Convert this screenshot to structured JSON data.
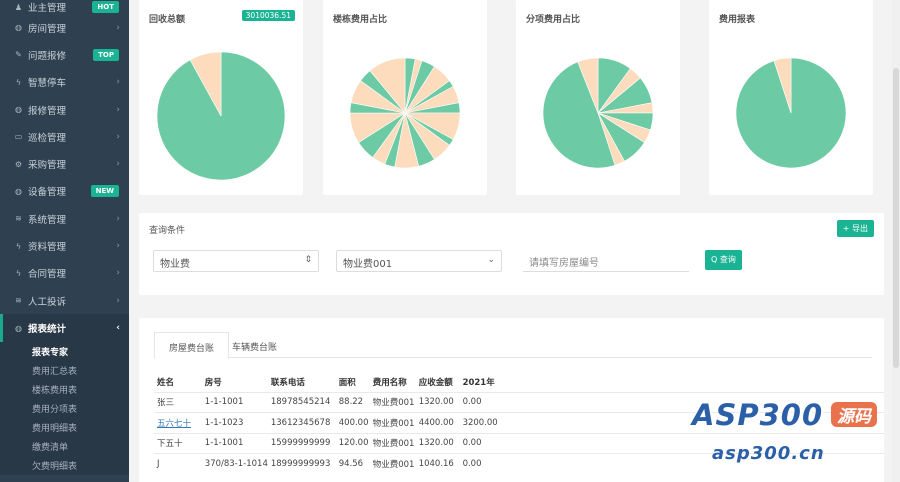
{
  "sidebar": {
    "items": [
      {
        "label": "业主管理",
        "icon": "user-icon",
        "badge": "HOT"
      },
      {
        "label": "房间管理",
        "icon": "globe-icon",
        "chevron": true
      },
      {
        "label": "问题报修",
        "icon": "edit-icon",
        "badge": "TOP"
      },
      {
        "label": "智慧停车",
        "icon": "bolt-icon",
        "chevron": true
      },
      {
        "label": "报修管理",
        "icon": "globe-icon",
        "chevron": true
      },
      {
        "label": "巡检管理",
        "icon": "monitor-icon",
        "chevron": true
      },
      {
        "label": "采购管理",
        "icon": "gear-icon",
        "chevron": true
      },
      {
        "label": "设备管理",
        "icon": "globe-icon",
        "badge": "NEW"
      },
      {
        "label": "系统管理",
        "icon": "wifi-icon",
        "chevron": true
      },
      {
        "label": "资料管理",
        "icon": "bolt-icon",
        "chevron": true
      },
      {
        "label": "合同管理",
        "icon": "bolt-icon",
        "chevron": true
      },
      {
        "label": "人工投诉",
        "icon": "wifi-icon",
        "chevron": true
      },
      {
        "label": "报表统计",
        "icon": "globe-icon",
        "chevron": true,
        "active": true
      }
    ],
    "submenu": [
      "报表专家",
      "费用汇总表",
      "楼栋费用表",
      "费用分项表",
      "费用明细表",
      "缴费清单",
      "欠费明细表"
    ]
  },
  "charts": [
    {
      "title": "回收总额",
      "badge": "3010036.51",
      "slices": [
        {
          "value": 92,
          "color": "#6ccba5"
        },
        {
          "value": 8,
          "color": "#fcdcbc"
        }
      ]
    },
    {
      "title": "楼栋费用占比",
      "slices": [
        {
          "value": 3,
          "color": "#6ccba5"
        },
        {
          "value": 2,
          "color": "#fcdcbc"
        },
        {
          "value": 4,
          "color": "#6ccba5"
        },
        {
          "value": 6,
          "color": "#fcdcbc"
        },
        {
          "value": 2,
          "color": "#6ccba5"
        },
        {
          "value": 5,
          "color": "#fcdcbc"
        },
        {
          "value": 3,
          "color": "#6ccba5"
        },
        {
          "value": 8,
          "color": "#fcdcbc"
        },
        {
          "value": 2,
          "color": "#6ccba5"
        },
        {
          "value": 6,
          "color": "#fcdcbc"
        },
        {
          "value": 5,
          "color": "#6ccba5"
        },
        {
          "value": 7,
          "color": "#fcdcbc"
        },
        {
          "value": 3,
          "color": "#6ccba5"
        },
        {
          "value": 4,
          "color": "#fcdcbc"
        },
        {
          "value": 6,
          "color": "#6ccba5"
        },
        {
          "value": 9,
          "color": "#fcdcbc"
        },
        {
          "value": 3,
          "color": "#6ccba5"
        },
        {
          "value": 7,
          "color": "#fcdcbc"
        },
        {
          "value": 4,
          "color": "#6ccba5"
        },
        {
          "value": 11,
          "color": "#fcdcbc"
        }
      ]
    },
    {
      "title": "分项费用占比",
      "slices": [
        {
          "value": 10,
          "color": "#6ccba5"
        },
        {
          "value": 4,
          "color": "#fcdcbc"
        },
        {
          "value": 8,
          "color": "#6ccba5"
        },
        {
          "value": 3,
          "color": "#fcdcbc"
        },
        {
          "value": 5,
          "color": "#6ccba5"
        },
        {
          "value": 4,
          "color": "#fcdcbc"
        },
        {
          "value": 8,
          "color": "#6ccba5"
        },
        {
          "value": 3,
          "color": "#fcdcbc"
        },
        {
          "value": 49,
          "color": "#6ccba5"
        },
        {
          "value": 6,
          "color": "#fcdcbc"
        }
      ]
    },
    {
      "title": "费用报表",
      "slices": [
        {
          "value": 95,
          "color": "#6ccba5"
        },
        {
          "value": 5,
          "color": "#fcdcbc"
        }
      ]
    }
  ],
  "filter": {
    "title": "查询条件",
    "export_label": "+ 导出",
    "select1": "物业费",
    "select2": "物业费001",
    "room_placeholder": "请填写房屋编号",
    "search_label": "Q 查询"
  },
  "tabs": [
    "房屋费台账",
    "车辆费台账"
  ],
  "table": {
    "headers": [
      "姓名",
      "房号",
      "联系电话",
      "面积",
      "费用名称",
      "应收金额",
      "2021年"
    ],
    "rows": [
      {
        "name": "张三",
        "room": "1-1-1001",
        "phone": "18978545214",
        "area": "88.22",
        "fee": "物业费001",
        "amount": "1320.00",
        "y2021": "0.00",
        "link": false
      },
      {
        "name": "五六七十",
        "room": "1-1-1023",
        "phone": "13612345678",
        "area": "400.00",
        "fee": "物业费001",
        "amount": "4400.00",
        "y2021": "3200.00",
        "link": true
      },
      {
        "name": "下五十",
        "room": "1-1-1001",
        "phone": "15999999999",
        "area": "120.00",
        "fee": "物业费001",
        "amount": "1320.00",
        "y2021": "0.00",
        "link": false
      },
      {
        "name": "J",
        "room": "370/83-1-1014",
        "phone": "18999999993",
        "area": "94.56",
        "fee": "物业费001",
        "amount": "1040.16",
        "y2021": "0.00",
        "link": false
      }
    ]
  },
  "watermark": {
    "brand": "ASP300",
    "badge": "源码",
    "domain": "asp300.cn"
  }
}
